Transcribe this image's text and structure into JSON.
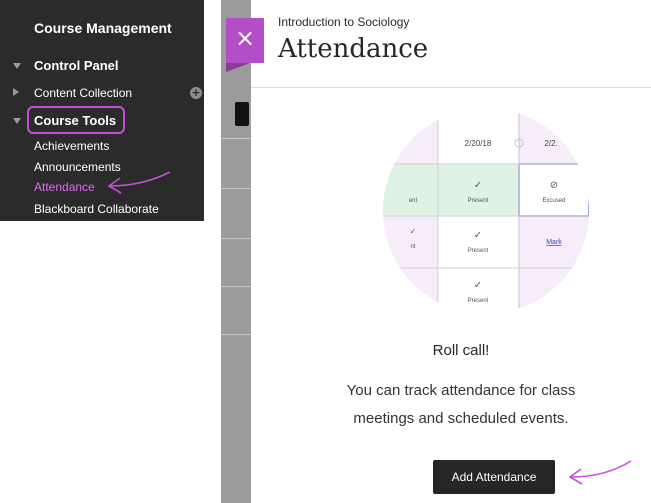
{
  "menu": {
    "header": "Course Management",
    "control_panel": "Control Panel",
    "content_collection": "Content Collection",
    "course_tools": "Course Tools",
    "items": [
      "Achievements",
      "Announcements",
      "Attendance",
      "Blackboard Collaborate"
    ]
  },
  "panel": {
    "subtitle": "Introduction to Sociology",
    "title": "Attendance",
    "close_label": "×",
    "illustration": {
      "dates": [
        "2/20/18",
        "2/2."
      ],
      "cells": {
        "r1": [
          "ent",
          "Present",
          "Excused"
        ],
        "r2": [
          "nt",
          "Present",
          "Mark"
        ],
        "r3": [
          "Present"
        ]
      }
    },
    "heading": "Roll call!",
    "description_line1": "You can track attendance for class",
    "description_line2": "meetings and scheduled events.",
    "add_button": "Add Attendance"
  },
  "colors": {
    "accent": "#b44ec6",
    "present_bg": "#dff3e4",
    "mark_link": "#2a4fb3"
  }
}
